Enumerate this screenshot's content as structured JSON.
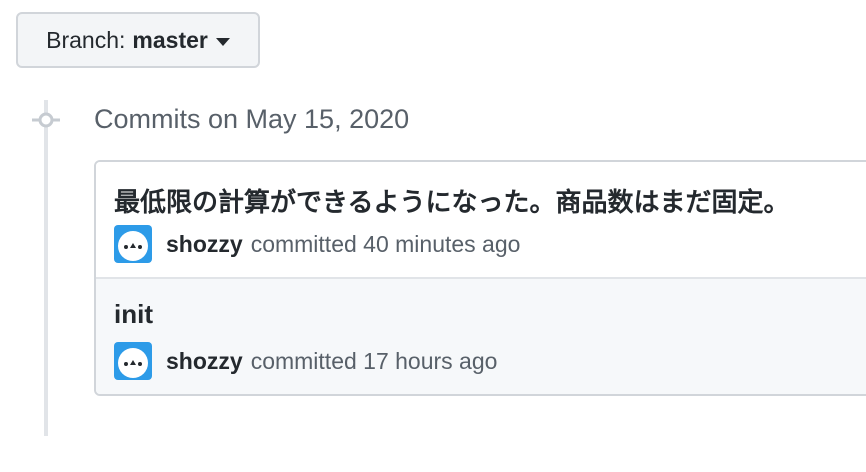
{
  "branch": {
    "prefix": "Branch:",
    "name": "master"
  },
  "commits_group": {
    "heading": "Commits on May 15, 2020",
    "commits": [
      {
        "title": "最低限の計算ができるようになった。商品数はまだ固定。",
        "author": "shozzy",
        "meta": "committed 40 minutes ago"
      },
      {
        "title": "init",
        "author": "shozzy",
        "meta": "committed 17 hours ago"
      }
    ]
  },
  "colors": {
    "avatar_bg": "#2d9be8",
    "timeline": "#e1e4e8",
    "muted_text": "#586069"
  }
}
